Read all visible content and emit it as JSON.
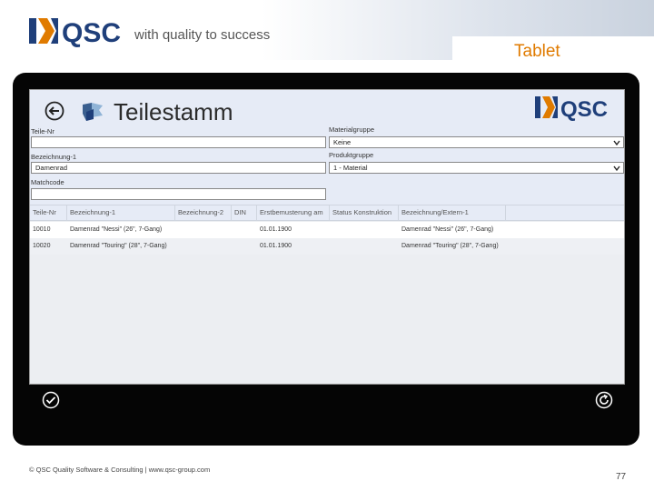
{
  "header": {
    "logo_text": "QSC",
    "tagline": "with quality to success",
    "slide_title": "Tablet"
  },
  "app": {
    "title": "Teilestamm",
    "logo_text": "QSC"
  },
  "form": {
    "teile_nr": {
      "label": "Teile-Nr",
      "value": ""
    },
    "bezeichnung1": {
      "label": "Bezeichnung-1",
      "value": "Damenrad"
    },
    "matchcode": {
      "label": "Matchcode",
      "value": ""
    },
    "materialgruppe": {
      "label": "Materialgruppe",
      "value": "Keine"
    },
    "produktgruppe": {
      "label": "Produktgruppe",
      "value": "1 - Material"
    }
  },
  "grid": {
    "columns": [
      "Teile-Nr",
      "Bezeichnung-1",
      "Bezeichnung-2",
      "DIN",
      "Erstbemusterung am",
      "Status Konstruktion",
      "Bezeichnung/Extern-1",
      ""
    ],
    "rows": [
      [
        "10010",
        "Damenrad \"Nessi\" (26\", 7-Gang)",
        "",
        "",
        "01.01.1900",
        "",
        "Damenrad \"Nessi\" (26\", 7-Gang)"
      ],
      [
        "10020",
        "Damenrad \"Touring\" (28\", 7-Gang)",
        "",
        "",
        "01.01.1900",
        "",
        "Damenrad \"Touring\" (28\", 7-Gang)"
      ]
    ]
  },
  "footer": {
    "copyright": "© QSC Quality Software & Consulting | www.qsc-group.com",
    "page_number": "77"
  },
  "colors": {
    "accent_orange": "#e07b00",
    "qsc_blue": "#1f3f7a",
    "qsc_orange": "#e07b00"
  }
}
